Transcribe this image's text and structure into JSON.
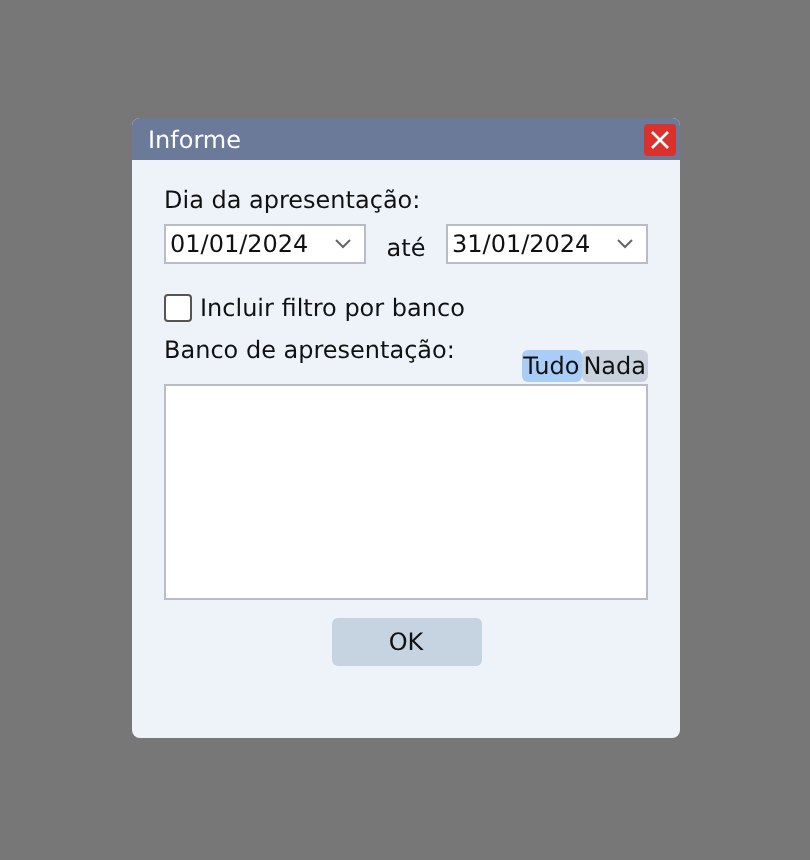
{
  "window": {
    "title": "Informe"
  },
  "date_range": {
    "label": "Dia da apresentação:",
    "from": "01/01/2024",
    "separator": "até",
    "to": "31/01/2024"
  },
  "bank_filter": {
    "label": "Incluir filtro por banco",
    "checked": false
  },
  "bank_list": {
    "label": "Banco de apresentação:",
    "toggles": [
      {
        "label": "Tudo",
        "selected": true
      },
      {
        "label": "Nada",
        "selected": false
      }
    ]
  },
  "buttons": [
    "OK"
  ]
}
